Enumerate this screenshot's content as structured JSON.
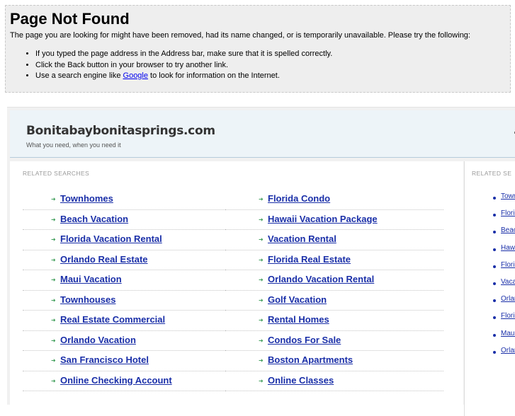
{
  "error": {
    "title": "Page Not Found",
    "description": "The page you are looking for might have been removed, had its name changed, or is temporarily unavailable. Please try the following:",
    "tip1": "If you typed the page address in the Address bar, make sure that it is spelled correctly.",
    "tip2": "Click the Back button in your browser to try another link.",
    "tip3_before": "Use a search engine like ",
    "tip3_link": "Google",
    "tip3_after": " to look for information on the Internet."
  },
  "site": {
    "name": "Bonitabaybonitasprings.com",
    "tagline": "What you need, when you need it"
  },
  "related": {
    "label": "RELATED SEARCHES",
    "side_label": "RELATED SE",
    "col1": [
      "Townhomes",
      "Beach Vacation",
      "Florida Vacation Rental",
      "Orlando Real Estate",
      "Maui Vacation",
      "Townhouses",
      "Real Estate Commercial",
      "Orlando Vacation",
      "San Francisco Hotel",
      "Online Checking Account"
    ],
    "col2": [
      "Florida Condo",
      "Hawaii Vacation Package",
      "Vacation Rental",
      "Florida Real Estate",
      "Orlando Vacation Rental",
      "Golf Vacation",
      "Rental Homes",
      "Condos For Sale",
      "Boston Apartments",
      "Online Classes"
    ],
    "side": [
      "Townh",
      "Florida",
      "Beach",
      "Hawaii",
      "Florida",
      "Vacati",
      "Orland",
      "Florida",
      "Maui V",
      "Orland"
    ],
    "arrow_glyph": "➜"
  },
  "colors": {
    "link": "#1a2fa8",
    "arrow": "#3f9e5a",
    "error_bg": "#eeeeee",
    "header_bg": "#edf4f8"
  }
}
